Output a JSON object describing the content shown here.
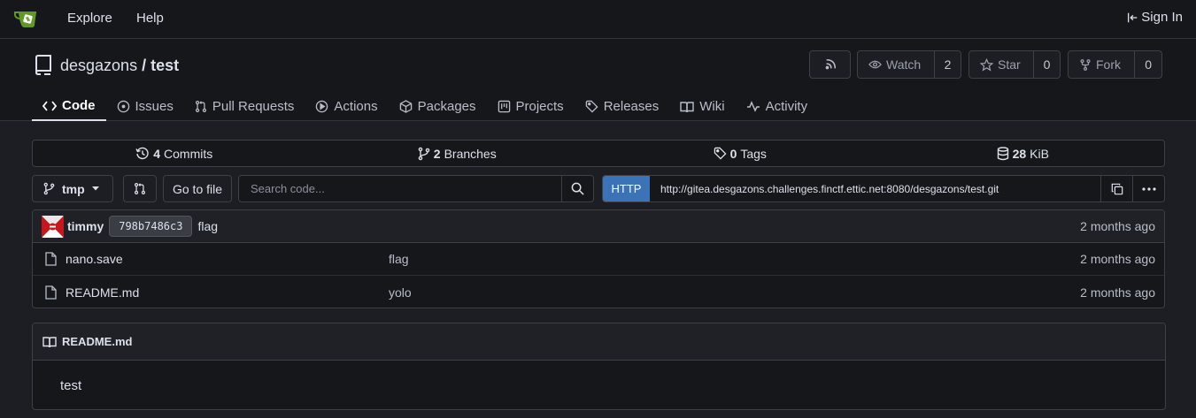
{
  "nav": {
    "links": [
      "Explore",
      "Help"
    ],
    "signin_label": "Sign In"
  },
  "repo": {
    "owner": "desgazons",
    "separator": "/",
    "name": "test",
    "watch_label": "Watch",
    "watch_count": "2",
    "star_label": "Star",
    "star_count": "0",
    "fork_label": "Fork",
    "fork_count": "0"
  },
  "tabs": [
    {
      "label": "Code",
      "icon": "code-icon",
      "active": true
    },
    {
      "label": "Issues",
      "icon": "issue-icon"
    },
    {
      "label": "Pull Requests",
      "icon": "pull-request-icon"
    },
    {
      "label": "Actions",
      "icon": "play-icon"
    },
    {
      "label": "Packages",
      "icon": "package-icon"
    },
    {
      "label": "Projects",
      "icon": "project-icon"
    },
    {
      "label": "Releases",
      "icon": "tag-icon"
    },
    {
      "label": "Wiki",
      "icon": "book-icon"
    },
    {
      "label": "Activity",
      "icon": "pulse-icon"
    }
  ],
  "stats": {
    "commits_count": "4",
    "commits_label": "Commits",
    "branches_count": "2",
    "branches_label": "Branches",
    "tags_count": "0",
    "tags_label": "Tags",
    "size_value": "28",
    "size_unit": "KiB"
  },
  "toolbar": {
    "branch": "tmp",
    "goto_file_label": "Go to file",
    "search_placeholder": "Search code...",
    "clone_protocol": "HTTP",
    "clone_url": "http://gitea.desgazons.challenges.finctf.ettic.net:8080/desgazons/test.git"
  },
  "latest_commit": {
    "author": "timmy",
    "sha": "798b7486c3",
    "message": "flag",
    "time": "2 months ago"
  },
  "files": [
    {
      "name": "nano.save",
      "message": "flag",
      "time": "2 months ago"
    },
    {
      "name": "README.md",
      "message": "yolo",
      "time": "2 months ago"
    }
  ],
  "readme": {
    "filename": "README.md",
    "content": "test"
  },
  "colors": {
    "accent": "#3a73b8",
    "logo_green": "#609926",
    "background": "#1c1e23"
  }
}
